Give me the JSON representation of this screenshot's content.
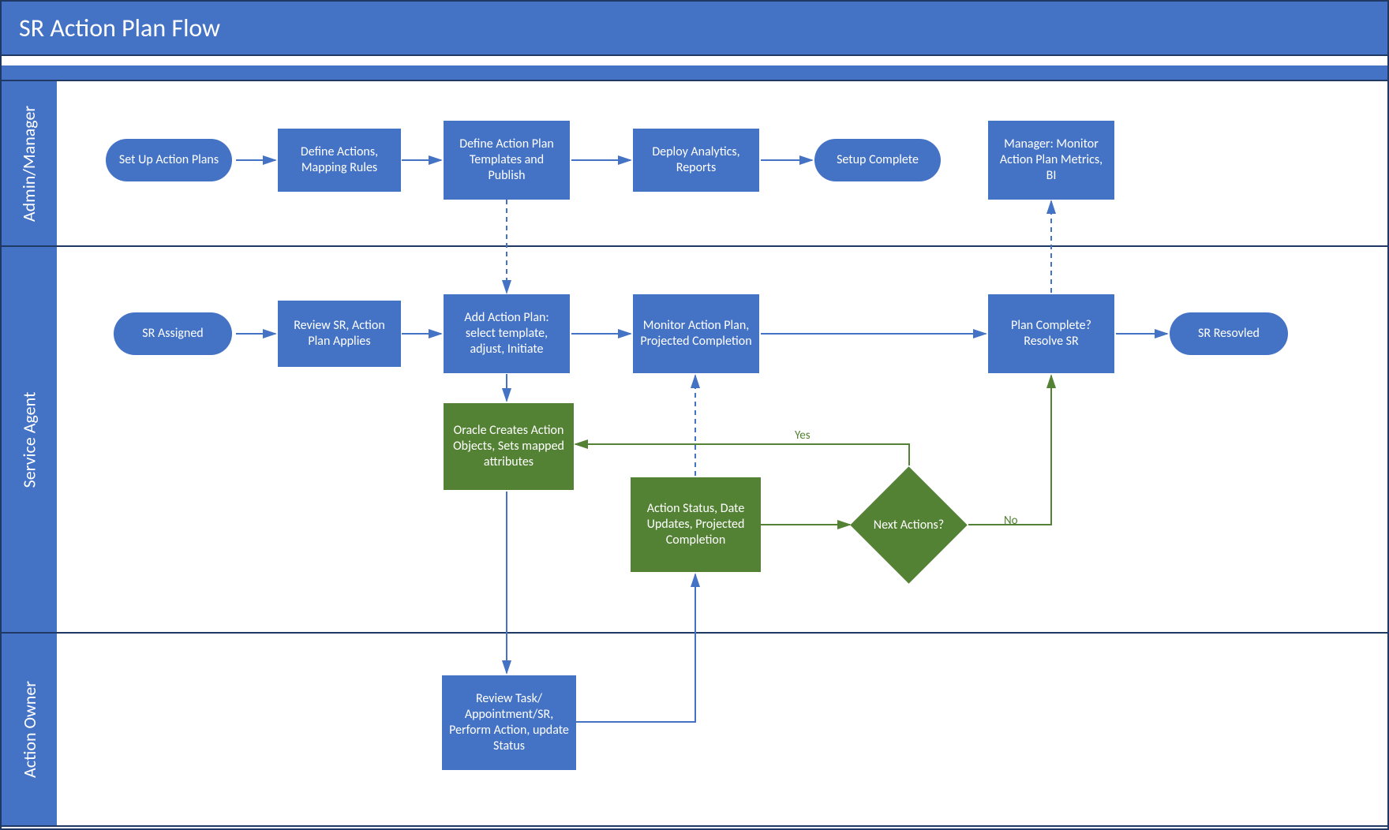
{
  "title": "SR Action Plan Flow",
  "lanes": {
    "admin": {
      "label": "Admin/Manager"
    },
    "agent": {
      "label": "Service Agent"
    },
    "owner": {
      "label": "Action Owner"
    }
  },
  "nodes": {
    "setup_plans": "Set Up Action Plans",
    "define_actions": "Define Actions, Mapping Rules",
    "define_templates": "Define Action Plan Templates and Publish",
    "deploy_analytics": "Deploy Analytics, Reports",
    "setup_complete": "Setup Complete",
    "manager_monitor": "Manager: Monitor Action Plan Metrics, BI",
    "sr_assigned": "SR Assigned",
    "review_sr": "Review SR, Action Plan Applies",
    "add_plan": "Add Action Plan: select template, adjust, Initiate",
    "monitor_plan": "Monitor Action Plan, Projected Completion",
    "plan_complete": "Plan Complete? Resolve SR",
    "sr_resolved": "SR Resovled",
    "oracle_creates": "Oracle Creates Action Objects, Sets mapped attributes",
    "action_status": "Action Status, Date Updates, Projected Completion",
    "next_actions": "Next Actions?",
    "review_task": "Review Task/ Appointment/SR, Perform Action, update Status"
  },
  "edge_labels": {
    "yes": "Yes",
    "no": "No"
  },
  "colors": {
    "blue": "#4472C4",
    "green": "#548235",
    "border": "#203864"
  }
}
